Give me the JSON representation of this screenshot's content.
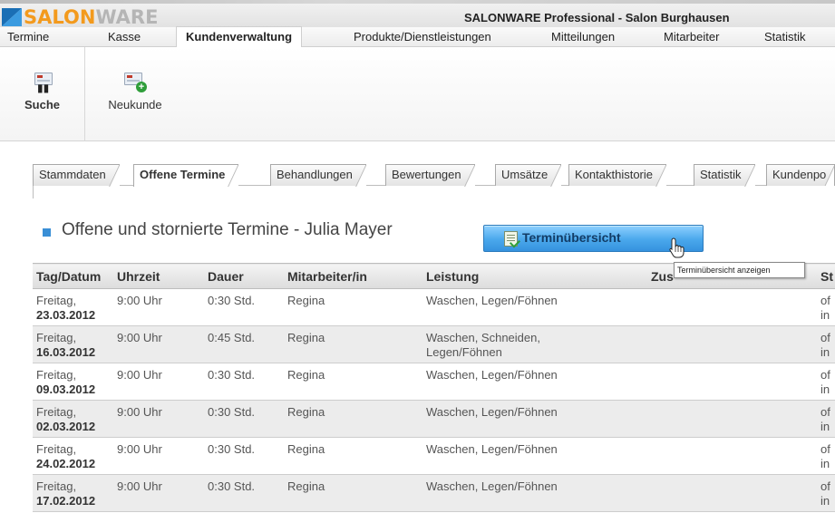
{
  "app": {
    "logo_part1": "SALON",
    "logo_part2": "WARE",
    "title": "SALONWARE Professional - Salon Burghausen"
  },
  "menu": {
    "items": [
      "Termine",
      "Kasse",
      "Kundenverwaltung",
      "Produkte/Dienstleistungen",
      "Mitteilungen",
      "Mitarbeiter",
      "Statistik"
    ],
    "active": "Kundenverwaltung"
  },
  "toolbar": {
    "search_label": "Suche",
    "new_customer_label": "Neukunde"
  },
  "tabs": {
    "items": [
      "Stammdaten",
      "Offene Termine",
      "Behandlungen",
      "Bewertungen",
      "Umsätze",
      "Kontakthistorie",
      "Statistik",
      "Kundenpo"
    ],
    "active": "Offene Termine"
  },
  "section": {
    "title": "Offene und stornierte Termine - Julia Mayer"
  },
  "overview_button": {
    "label": "Terminübersicht",
    "tooltip": "Terminübersicht anzeigen"
  },
  "table": {
    "headers": [
      "Tag/Datum",
      "Uhrzeit",
      "Dauer",
      "Mitarbeiter/in",
      "Leistung",
      "Zus",
      "St"
    ],
    "rows": [
      {
        "day": "Freitag,",
        "date": "23.03.2012",
        "time": "9:00 Uhr",
        "duration": "0:30 Std.",
        "employee": "Regina",
        "service1": "Waschen, Legen/Föhnen",
        "service2": "",
        "extra": "",
        "status1": "of",
        "status2": "in"
      },
      {
        "day": "Freitag,",
        "date": "16.03.2012",
        "time": "9:00 Uhr",
        "duration": "0:45 Std.",
        "employee": "Regina",
        "service1": "Waschen, Schneiden,",
        "service2": "Legen/Föhnen",
        "extra": "",
        "status1": "of",
        "status2": "in"
      },
      {
        "day": "Freitag,",
        "date": "09.03.2012",
        "time": "9:00 Uhr",
        "duration": "0:30 Std.",
        "employee": "Regina",
        "service1": "Waschen, Legen/Föhnen",
        "service2": "",
        "extra": "",
        "status1": "of",
        "status2": "in"
      },
      {
        "day": "Freitag,",
        "date": "02.03.2012",
        "time": "9:00 Uhr",
        "duration": "0:30 Std.",
        "employee": "Regina",
        "service1": "Waschen, Legen/Föhnen",
        "service2": "",
        "extra": "",
        "status1": "of",
        "status2": "in"
      },
      {
        "day": "Freitag,",
        "date": "24.02.2012",
        "time": "9:00 Uhr",
        "duration": "0:30 Std.",
        "employee": "Regina",
        "service1": "Waschen, Legen/Föhnen",
        "service2": "",
        "extra": "",
        "status1": "of",
        "status2": "in"
      },
      {
        "day": "Freitag,",
        "date": "17.02.2012",
        "time": "9:00 Uhr",
        "duration": "0:30 Std.",
        "employee": "Regina",
        "service1": "Waschen, Legen/Föhnen",
        "service2": "",
        "extra": "",
        "status1": "of",
        "status2": "in"
      }
    ]
  },
  "colors": {
    "logo_orange": "#f39a1d",
    "logo_gray": "#b5b5b5",
    "accent_blue": "#3a8fd6",
    "button_blue": "#4aa8ec"
  }
}
